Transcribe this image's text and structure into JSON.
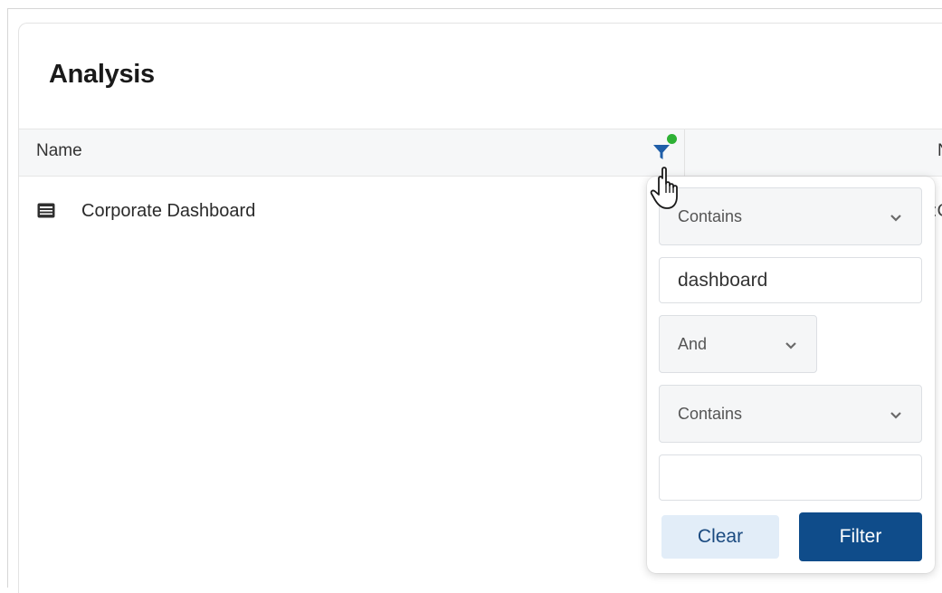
{
  "panel": {
    "title": "Analysis"
  },
  "grid": {
    "columns": [
      {
        "label": "Name",
        "filter_active": true
      },
      {
        "label": "N"
      }
    ],
    "rows": [
      {
        "name": "Corporate Dashboard",
        "next_cell": ":C",
        "icon": "dashboard-icon"
      }
    ]
  },
  "filter_popup": {
    "condition1": {
      "operator": "Contains",
      "value": "dashboard"
    },
    "join_operator": "And",
    "condition2": {
      "operator": "Contains",
      "value": ""
    },
    "clear_label": "Clear",
    "filter_label": "Filter"
  },
  "colors": {
    "accent": "#0f4c8a",
    "filter_icon": "#1f5ea8",
    "active_dot": "#2eb135",
    "clear_button_bg": "#e2edf8"
  }
}
